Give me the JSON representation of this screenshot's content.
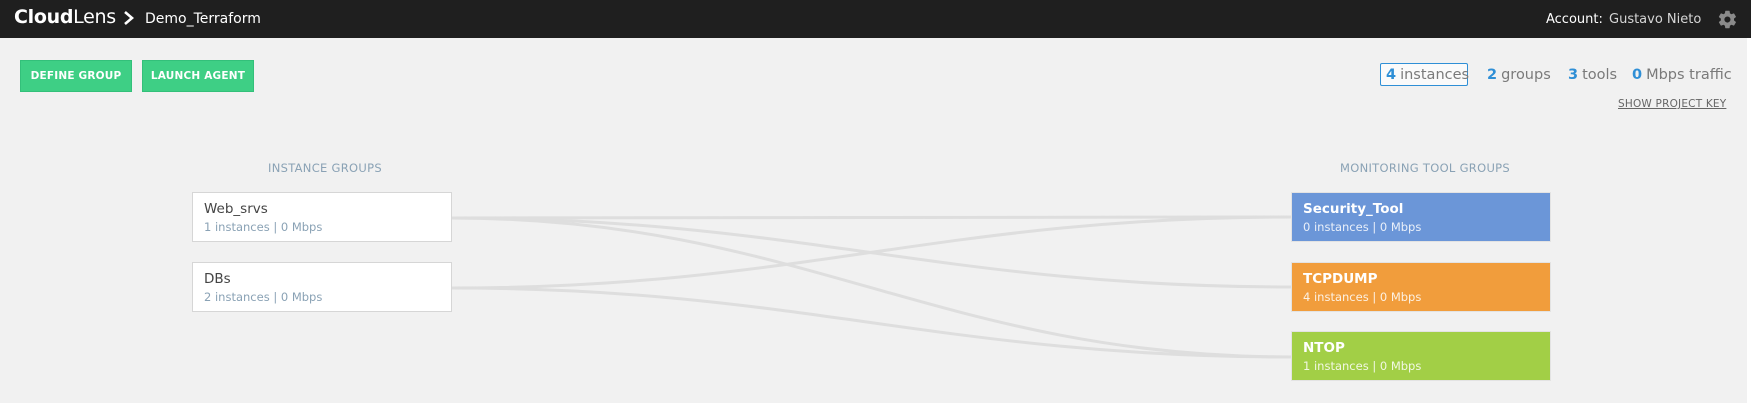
{
  "header": {
    "logo_bold": "Cloud",
    "logo_light": "Lens",
    "project_name": "Demo_Terraform",
    "account_label": "Account:",
    "account_name": "Gustavo Nieto"
  },
  "toolbar": {
    "define_group": "DEFINE GROUP",
    "launch_agent": "LAUNCH AGENT"
  },
  "stats": {
    "instances_count": "4",
    "instances_label": "instances",
    "groups_count": "2",
    "groups_label": "groups",
    "tools_count": "3",
    "tools_label": "tools",
    "traffic_count": "0",
    "traffic_label": "Mbps traffic",
    "show_key": "SHOW PROJECT KEY"
  },
  "instance_groups": {
    "label": "INSTANCE GROUPS",
    "items": [
      {
        "name": "Web_srvs",
        "meta": "1 instances | 0 Mbps"
      },
      {
        "name": "DBs",
        "meta": "2 instances | 0 Mbps"
      }
    ]
  },
  "tool_groups": {
    "label": "MONITORING TOOL GROUPS",
    "items": [
      {
        "name": "Security_Tool",
        "meta": "0 instances | 0 Mbps",
        "color": "#6b96d8"
      },
      {
        "name": "TCPDUMP",
        "meta": "4 instances | 0 Mbps",
        "color": "#f19d3c"
      },
      {
        "name": "NTOP",
        "meta": "1 instances | 0 Mbps",
        "color": "#a2cf46"
      }
    ]
  },
  "colors": {
    "accent_green": "#3ecf85",
    "accent_blue": "#2f8fd6",
    "topbar": "#1f1f1f"
  }
}
